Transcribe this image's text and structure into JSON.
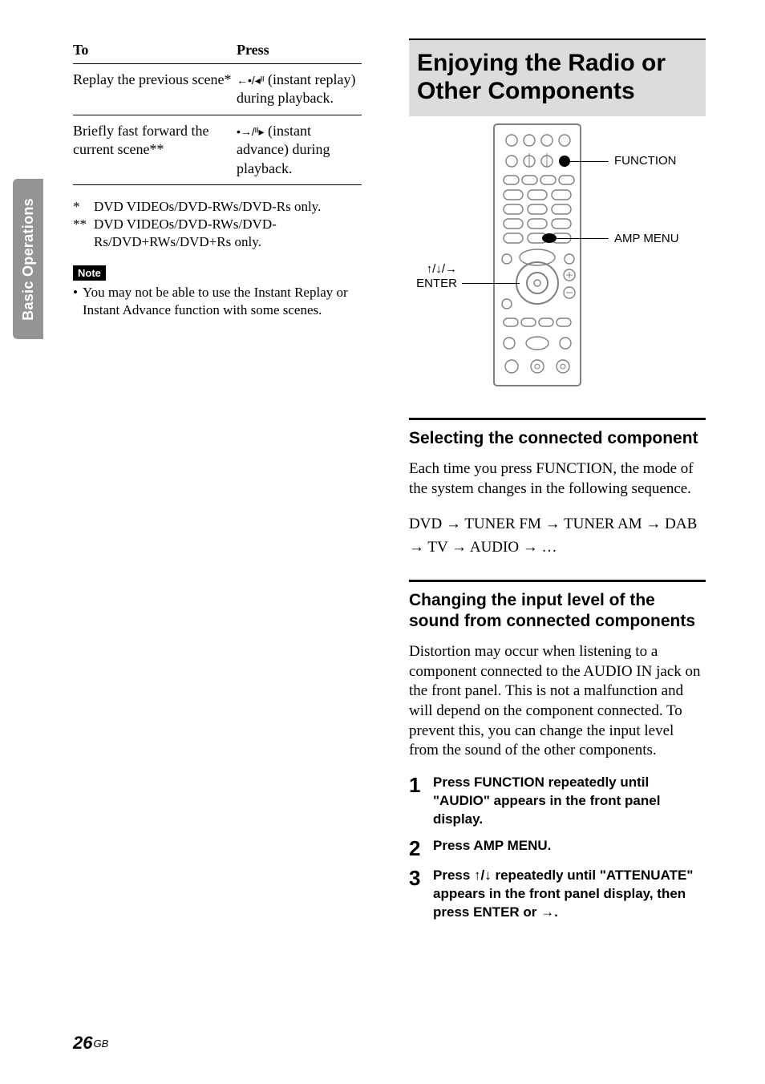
{
  "sidebar": {
    "section_label": "Basic Operations"
  },
  "table": {
    "col_to": "To",
    "col_press": "Press",
    "rows": [
      {
        "to": "Replay the previous scene*",
        "press_glyph": "←•/◂ᴵᴵ",
        "press_text": " (instant replay) during playback."
      },
      {
        "to": "Briefly fast forward the current scene**",
        "press_glyph": "•→/ᴵᴵ▸",
        "press_text": " (instant advance) during playback."
      }
    ]
  },
  "footnotes": [
    {
      "mark": "*",
      "text": "DVD VIDEOs/DVD-RWs/DVD-Rs only."
    },
    {
      "mark": "**",
      "text": "DVD VIDEOs/DVD-RWs/DVD-Rs/DVD+RWs/DVD+Rs only."
    }
  ],
  "note": {
    "label": "Note",
    "items": [
      "You may not be able to use the Instant Replay or Instant Advance function with some scenes."
    ]
  },
  "banner": {
    "title": "Enjoying the Radio or Other Components"
  },
  "remote_labels": {
    "function": "FUNCTION",
    "amp_menu": "AMP MENU",
    "arrows": "↑/↓/→",
    "enter": "ENTER"
  },
  "section1": {
    "title": "Selecting the connected component",
    "body": "Each time you press FUNCTION, the mode of the system changes in the following sequence.",
    "sequence": "DVD → TUNER FM → TUNER AM → DAB → TV → AUDIO → …"
  },
  "section2": {
    "title": "Changing the input level of the sound from connected components",
    "body": "Distortion may occur when listening to a component connected to the AUDIO IN jack on the front panel. This is not a malfunction and will depend on the component connected. To prevent this, you can change the input level from the sound of the other components.",
    "steps": [
      "Press FUNCTION repeatedly until \"AUDIO\" appears in the front panel display.",
      "Press AMP MENU.",
      "Press ↑/↓ repeatedly until \"ATTENUATE\" appears in the front panel display, then press ENTER or →."
    ]
  },
  "page_number": {
    "num": "26",
    "suffix": "GB"
  }
}
